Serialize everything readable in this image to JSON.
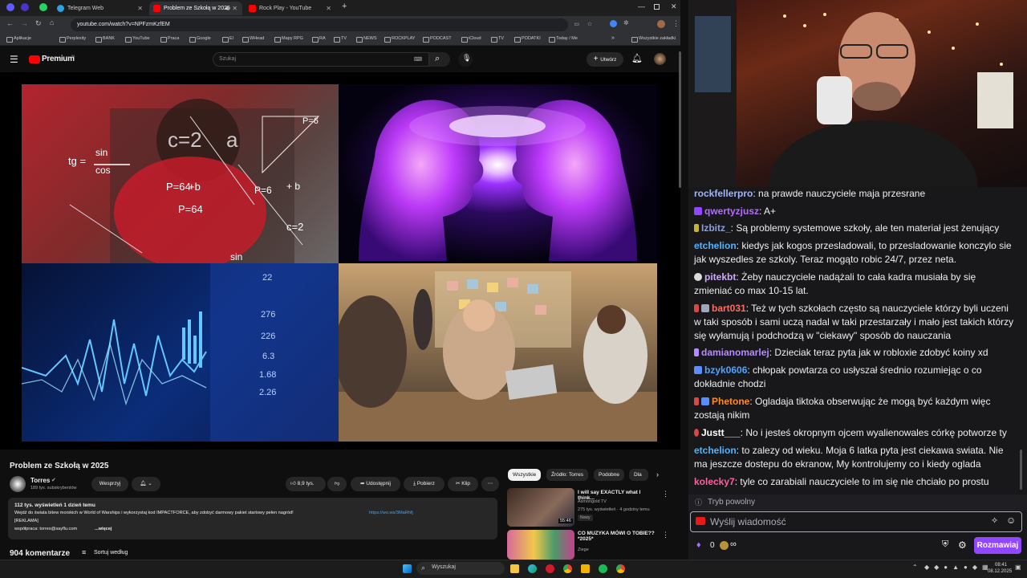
{
  "browser": {
    "tabs": [
      {
        "title": "Telegram Web"
      },
      {
        "title": "Problem ze Szkołą w 2025"
      },
      {
        "title": "Rock Play - YouTube"
      }
    ],
    "url": "youtube.com/watch?v=NPFzmKzfEM",
    "bookmarks": [
      "Aplikacje",
      "Perplexity",
      "BANK",
      "YouTube",
      "Praca",
      "Google",
      "El",
      "WHead",
      "Mapy RPG",
      "RA",
      "TV",
      "NEWS",
      "ROCKPLAY",
      "PODCAST",
      "iCloud",
      "TV",
      "PODATKI",
      "Today / Me",
      "Wszystkie zakładki"
    ]
  },
  "youtube": {
    "logo": "Premium",
    "logo_sup": "PL",
    "search_placeholder": "Szukaj",
    "create_label": "Utwórz",
    "video_title": "Problem ze Szkołą w 2025",
    "channel_name": "Torres",
    "subscribers": "189 tys. subskrybentów",
    "support_label": "Wesprzyj",
    "like_count": "8,9 tys.",
    "share_label": "Udostępnij",
    "download_label": "Pobierz",
    "clip_label": "Klip",
    "description": {
      "stats": "112 tys. wyświetleń  1 dzień temu",
      "line1": "Wejdź do świata bitew morskich w World of Warships i wykorzystaj kod IMPACTFORCE, aby zdobyć darmowy pakiet startowy pełen nagród!",
      "link": "https://wo.ws/3MaRhfj",
      "line2": "[REKLAMA]",
      "line3": "współpraca: torres@sayflu.com",
      "more": "...więcej"
    },
    "comments_count": "904 komentarze",
    "sort_label": "Sortuj według",
    "chips": [
      "Wszystkie",
      "Źródło: Torres",
      "Podobne",
      "Dla C"
    ],
    "recommended": [
      {
        "title": "I will say EXACTLY what I think...",
        "channel": "Asmongold TV",
        "meta": "275 tys. wyświetleń · 4 godziny temu",
        "badge": "Nowy",
        "duration": "55:46"
      },
      {
        "title": "CO MUZYKA MÓWI O TOBIE?? *2025*",
        "channel": "Ziege",
        "meta": "",
        "badge": "",
        "duration": ""
      }
    ],
    "video_overlay_text": [
      "tg =",
      "sin",
      "cos",
      "c=2",
      "a",
      "P=64",
      "P=6",
      "+b",
      "P=64",
      "c=2",
      "sin",
      "P=6",
      "+ b"
    ],
    "ticker_numbers": [
      "22",
      "276",
      "226",
      "6.3",
      "1.68",
      "2.26"
    ]
  },
  "stream": {
    "chat": [
      {
        "user": "rockfellerpro",
        "color": "#a0b4ff",
        "text": "na prawde nauczyciele maja przesrane"
      },
      {
        "user": "qwertyzjusz",
        "color": "#b46cff",
        "text": "A+"
      },
      {
        "user": "Izbitz_",
        "color": "#8c9fdc",
        "text": "Są problemy systemowe szkoły, ale ten materiał jest żenujący"
      },
      {
        "user": "etchelion",
        "color": "#4fb4ff",
        "text": "kiedys jak kogos przesladowali, to przesladowanie konczylo sie jak wyszedles ze szkoly. Teraz mogąto robic 24/7, przez neta."
      },
      {
        "user": "pitekbt",
        "color": "#d0a8ff",
        "text": "Żeby nauczyciele nadążali to cała kadra musiała by się zmieniać co max 10-15 lat."
      },
      {
        "user": "bart031",
        "color": "#ff6b5f",
        "text": "Też w tych szkołach często są nauczyciele którzy byli uczeni w taki sposób i sami uczą nadal w taki przestarzały i mało jest takich którzy się wyłamują i podchodzą w \"ciekawy\" sposób do nauczania"
      },
      {
        "user": "damianomarlej",
        "color": "#b38cff",
        "text": "Dzieciak teraz pyta jak w robloxie zdobyć koiny xd"
      },
      {
        "user": "bzyk0606",
        "color": "#4fa3ff",
        "text": "chłopak powtarza co usłyszał średnio rozumiejąc o co dokładnie chodzi"
      },
      {
        "user": "Phetone",
        "color": "#ff8c1a",
        "text": "Ogladaja tiktoka obserwując że mogą być każdym więc zostają nikim"
      },
      {
        "user": "Justt___",
        "color": "#ffffff",
        "text": "No i jesteś okropnym ojcem wyalienowales córkę potworze ty"
      },
      {
        "user": "etchelion",
        "color": "#4fb4ff",
        "text": "to zalezy od wieku. Moja 6 latka pyta jest ciekawa swiata. Nie ma jeszcze dostepu do ekranow, My kontrolujemy co i kiedy oglada"
      },
      {
        "user": "kolecky7",
        "color": "#ff5fa2",
        "text": "tyle co zarabiali nauczyciele to im się nie chciało po prostu"
      }
    ],
    "slow_mode": "Tryb powolny",
    "input_placeholder": "Wyślij wiadomość",
    "points": "0",
    "send_label": "Rozmawiaj"
  },
  "taskbar": {
    "search_label": "Wyszukaj",
    "time": "08:41",
    "date": "08.12.2025"
  }
}
